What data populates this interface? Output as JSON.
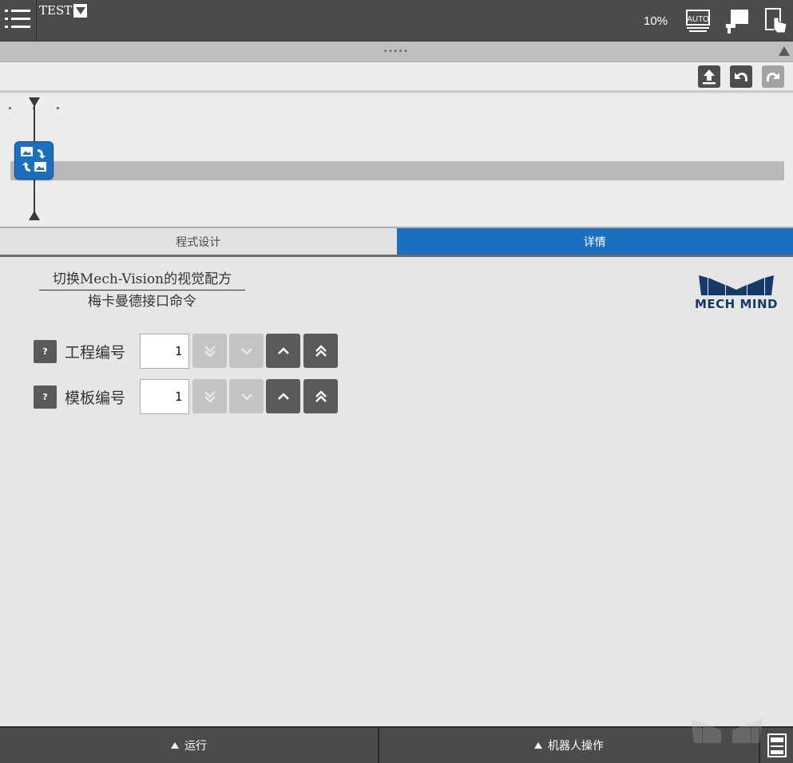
{
  "topbar": {
    "program_name": "TEST",
    "speed": "10%",
    "auto_label": "AUTO"
  },
  "handle": {
    "dots": "•••••"
  },
  "tabs": [
    {
      "label": "程式设计",
      "active": false
    },
    {
      "label": "详情",
      "active": true
    }
  ],
  "detail": {
    "title": "切换Mech-Vision的视觉配方",
    "subtitle": "梅卡曼德接口命令",
    "logo_text": "MECH MIND",
    "params": [
      {
        "label": "工程编号",
        "value": "1",
        "help": "?"
      },
      {
        "label": "模板编号",
        "value": "1",
        "help": "?"
      }
    ]
  },
  "bottombar": {
    "run_label": "运行",
    "robot_label": "机器人操作"
  },
  "colors": {
    "accent": "#1a6fc1",
    "bar": "#4b4b4b",
    "background": "#e6e6e6"
  },
  "icons": [
    "menu-icon",
    "dropdown-icon",
    "auto-mode-icon",
    "robot-pendant-icon",
    "touch-icon",
    "upload-icon",
    "undo-icon",
    "redo-icon",
    "recipe-switch-icon",
    "chevron-double-down-icon",
    "chevron-down-icon",
    "chevron-up-icon",
    "chevron-double-up-icon",
    "keyboard-icon"
  ]
}
